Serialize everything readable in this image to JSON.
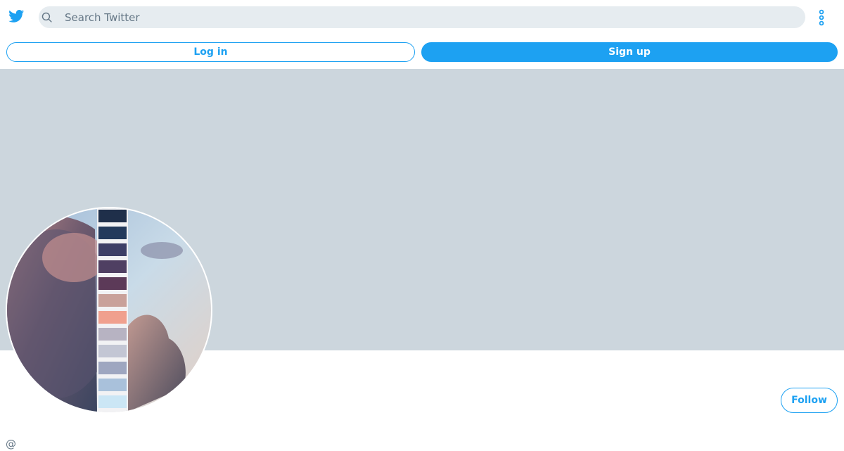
{
  "header": {
    "logo_icon": "twitter-bird-icon",
    "search": {
      "placeholder": "Search Twitter",
      "value": ""
    },
    "more_icon": "more-vertical-icon"
  },
  "auth": {
    "login_label": "Log in",
    "signup_label": "Sign up"
  },
  "profile": {
    "follow_label": "Follow",
    "handle": "@"
  },
  "colors": {
    "accent": "#1da1f2",
    "banner": "#ccd6dd",
    "search_bg": "#e6ecf0",
    "muted_text": "#657786"
  }
}
